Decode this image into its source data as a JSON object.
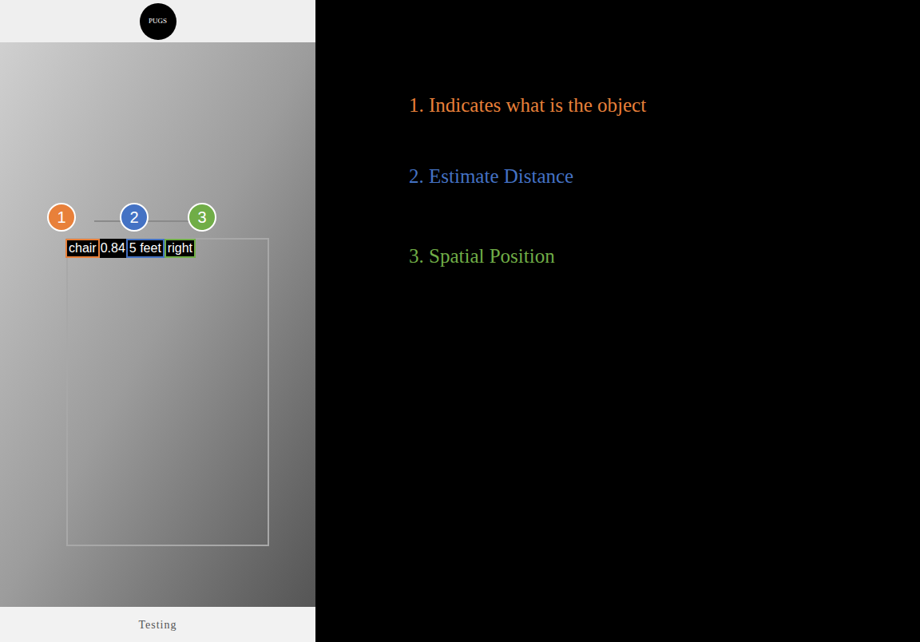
{
  "app": {
    "logo": "PUGS",
    "footer": "Testing"
  },
  "detection": {
    "label": "chair",
    "score": "0.84",
    "distance": "5 feet",
    "position": "right"
  },
  "callouts": [
    {
      "number": "1",
      "color": "#e8803a"
    },
    {
      "number": "2",
      "color": "#4472c4"
    },
    {
      "number": "3",
      "color": "#70ad47"
    }
  ],
  "legend": [
    {
      "text": "1. Indicates what is the object",
      "color": "#e8803a"
    },
    {
      "text": "2. Estimate Distance",
      "color": "#4472c4"
    },
    {
      "text": "3. Spatial Position",
      "color": "#70ad47"
    }
  ]
}
